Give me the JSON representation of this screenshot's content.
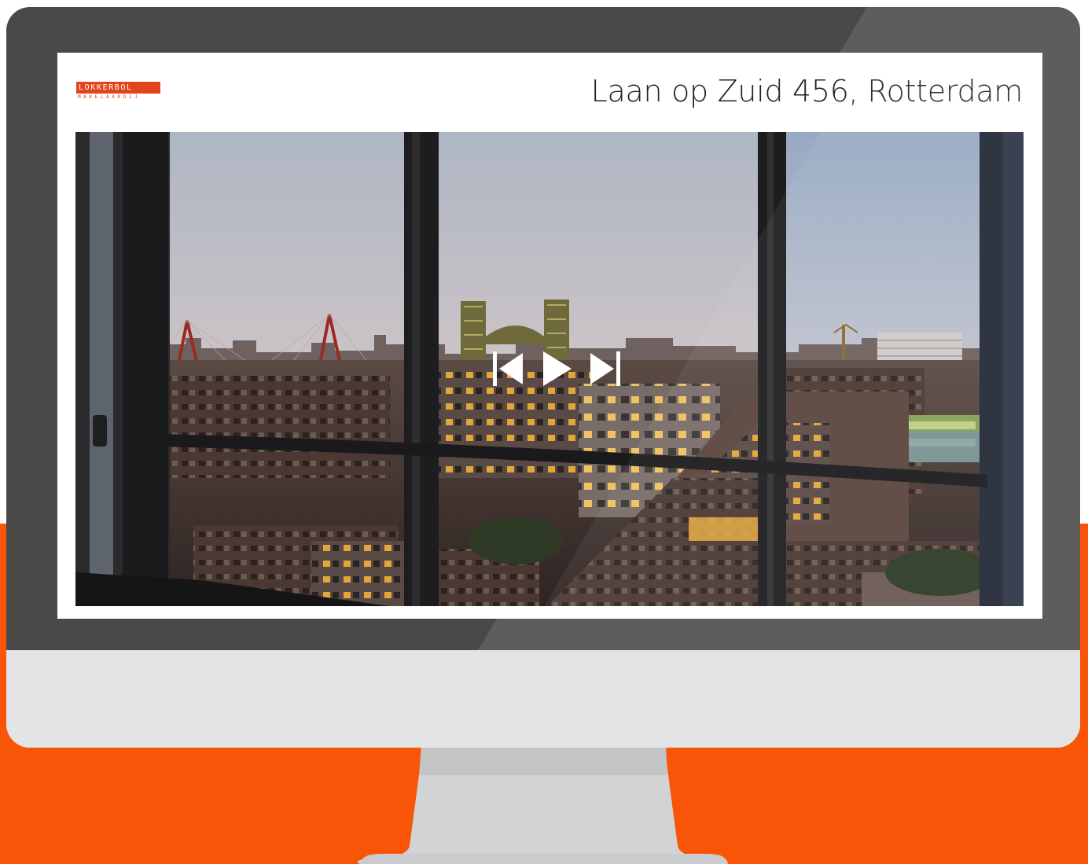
{
  "brand": {
    "logo_main": "LOKKERBOL",
    "logo_sub": "MAKELAARDIJ"
  },
  "listing": {
    "address": "Laan op Zuid 456, Rotterdam"
  },
  "slideshow": {
    "photo": "city-view-through-window",
    "controls": {
      "previous": "skip-previous-icon",
      "play": "play-icon",
      "next": "skip-next-icon"
    }
  },
  "colors": {
    "accent": "#f95508",
    "logo": "#e2441b",
    "bezel": "#4a4948",
    "chin": "#e3e4e6",
    "stand": "#c9cbcd"
  }
}
